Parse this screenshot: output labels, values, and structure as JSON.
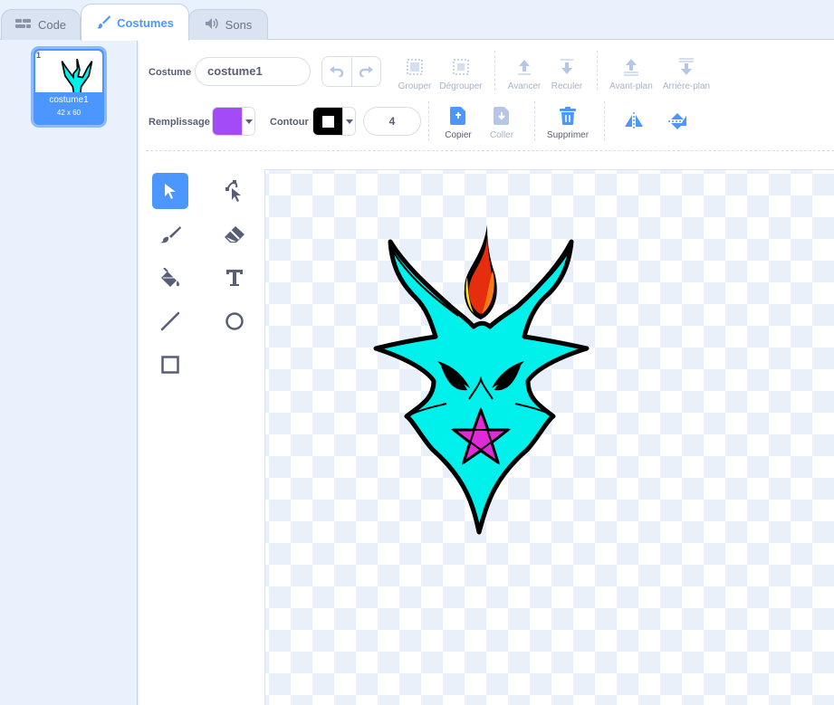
{
  "tabs": [
    {
      "label": "Code",
      "icon": "code-icon"
    },
    {
      "label": "Costumes",
      "icon": "brush-icon"
    },
    {
      "label": "Sons",
      "icon": "speaker-icon"
    }
  ],
  "costumes": [
    {
      "number": "1",
      "name": "costume1",
      "size": "42 x 60"
    }
  ],
  "toolbar": {
    "costume_label": "Costume",
    "costume_name": "costume1",
    "group": "Grouper",
    "ungroup": "Dégrouper",
    "forward": "Avancer",
    "backward": "Reculer",
    "front": "Avant-plan",
    "back": "Arrière-plan",
    "fill_label": "Remplissage",
    "outline_label": "Contour",
    "outline_width": "4",
    "copy": "Copier",
    "paste": "Coller",
    "delete": "Supprimer"
  },
  "colors": {
    "accent": "#4c97ff",
    "fill": "#a24bf7",
    "outline": "#000000",
    "dragon_body": "#00f0ec",
    "pentagram": "#e02ad7",
    "flame_outer": "#e62e0f",
    "flame_inner": "#f57b14",
    "flame_yellow": "#f5e21a"
  },
  "tools": [
    "select-icon",
    "reshape-icon",
    "brush-icon",
    "eraser-icon",
    "fill-icon",
    "text-icon",
    "line-icon",
    "circle-icon",
    "rectangle-icon"
  ]
}
